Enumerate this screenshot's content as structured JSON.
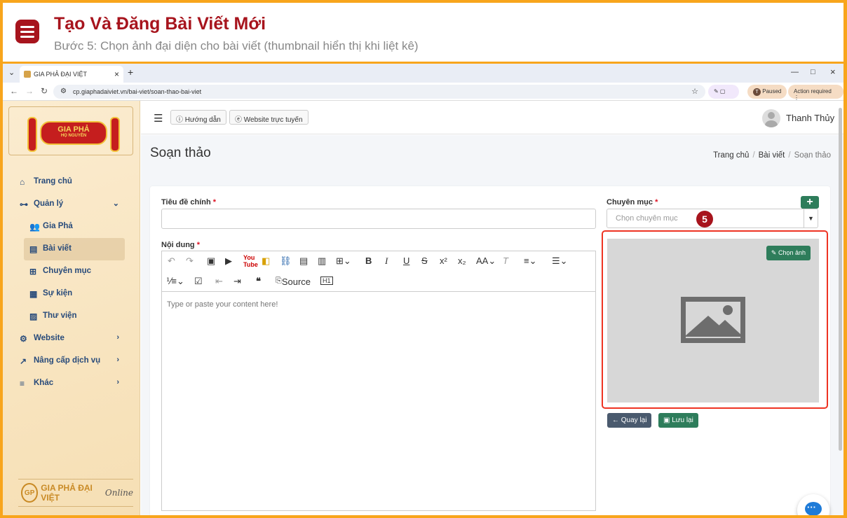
{
  "tutorial": {
    "title": "Tạo Và Đăng Bài Viết Mới",
    "subtitle": "Bước 5: Chọn ảnh đại diện cho bài viết (thumbnail hiển thị khi liệt kê)"
  },
  "browser": {
    "tab_title": "GIA PHẢ ĐẠI VIỆT",
    "url": "cp.giaphadaiviet.vn/bai-viet/soan-thao-bai-viet",
    "profile_label": "Paused",
    "profile_initial": "T",
    "action_label": "Action required"
  },
  "sidebar": {
    "brand_text": "GIA PHẢ ĐẠI VIỆT",
    "brand_script": "Online",
    "logo_title": "GIA PHẢ",
    "logo_sub": "HỌ NGUYỄN",
    "items": [
      {
        "label": "Trang chủ",
        "icon": "home-icon"
      },
      {
        "label": "Quản lý",
        "icon": "sitemap-icon"
      },
      {
        "label": "Gia Phả",
        "icon": "users-icon"
      },
      {
        "label": "Bài viết",
        "icon": "newspaper-icon"
      },
      {
        "label": "Chuyên mục",
        "icon": "grid-icon"
      },
      {
        "label": "Sự kiện",
        "icon": "calendar-icon"
      },
      {
        "label": "Thư viện",
        "icon": "images-icon"
      },
      {
        "label": "Website",
        "icon": "gear-icon"
      },
      {
        "label": "Nâng cấp dịch vụ",
        "icon": "chart-icon"
      },
      {
        "label": "Khác",
        "icon": "bars-icon"
      }
    ]
  },
  "topnav": {
    "guide_label": "Hướng dẫn",
    "website_label": "Website trực tuyến",
    "user_name": "Thanh Thủy"
  },
  "page": {
    "title": "Soạn thảo",
    "breadcrumb": [
      "Trang chủ",
      "Bài viết",
      "Soạn thảo"
    ]
  },
  "form": {
    "title_label": "Tiêu đề chính",
    "content_label": "Nội dung",
    "required_mark": "*",
    "editor_placeholder": "Type or paste your content here!",
    "source_label": "Source",
    "category_label": "Chuyên mục",
    "category_placeholder": "Chọn chuyên mục",
    "choose_image_label": "Chọn ảnh",
    "back_label": "Quay lại",
    "save_label": "Lưu lại",
    "step_number": "5"
  },
  "colors": {
    "accent": "#2e7d5b",
    "brand_red": "#a7141d",
    "frame": "#f8a51c",
    "back_button": "#4a5a6e"
  }
}
